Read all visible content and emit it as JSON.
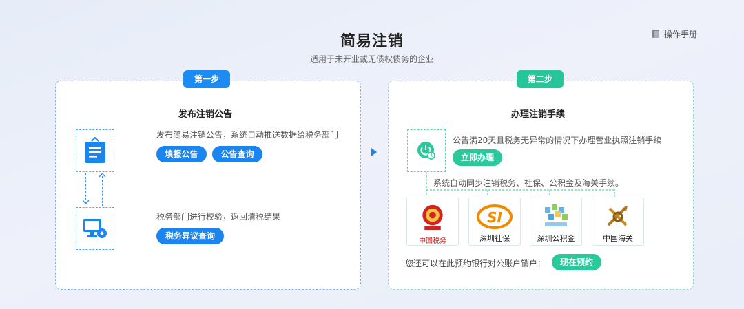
{
  "header": {
    "title": "简易注销",
    "subtitle": "适用于未开业或无债权债务的企业",
    "manual_label": "操作手册"
  },
  "step1": {
    "badge": "第一步",
    "title": "发布注销公告",
    "item1_desc": "发布简易注销公告，系统自动推送数据给税务部门",
    "btn_fill": "填报公告",
    "btn_query": "公告查询",
    "item2_desc": "税务部门进行校验，返回清税结果",
    "btn_dispute": "税务异议查询"
  },
  "step2": {
    "badge": "第二步",
    "title": "办理注销手续",
    "desc": "公告满20天且税务无异常的情况下办理营业执照注销手续",
    "btn_handle": "立即办理",
    "sync_text": "系统自动同步注销税务、社保、公积金及海关手续。",
    "logos": [
      {
        "icon": "tax-emblem-icon",
        "text": "中国税务"
      },
      {
        "icon": "social-security-logo-icon",
        "label": "深圳社保"
      },
      {
        "icon": "housing-fund-logo-icon",
        "label": "深圳公积金"
      },
      {
        "icon": "customs-emblem-icon",
        "label": "中国海关"
      }
    ],
    "bank_text": "您还可以在此预约银行对公账户销户：",
    "btn_reserve": "现在预约"
  },
  "colors": {
    "blue": "#1a84ef",
    "green": "#2ac89b",
    "red": "#d3231e",
    "orange": "#f08a00"
  }
}
